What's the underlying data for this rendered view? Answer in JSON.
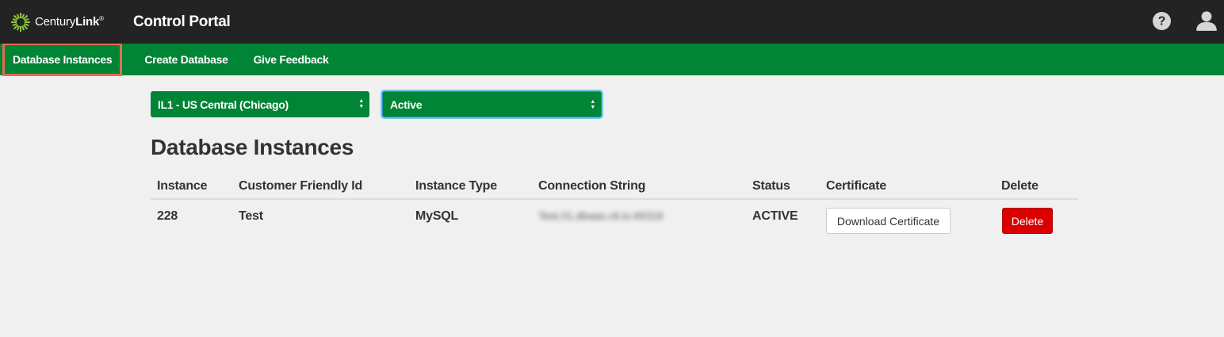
{
  "brand": {
    "name_light": "Century",
    "name_bold": "Link",
    "reg": "®",
    "portal_title": "Control Portal"
  },
  "header_icons": [
    "help-icon",
    "user-icon"
  ],
  "nav": {
    "items": [
      {
        "label": "Database Instances",
        "active": true
      },
      {
        "label": "Create Database"
      },
      {
        "label": "Give Feedback"
      }
    ]
  },
  "filters": {
    "location": "IL1 - US Central (Chicago)",
    "status": "Active"
  },
  "page": {
    "heading": "Database Instances"
  },
  "table": {
    "columns": [
      "Instance",
      "Customer Friendly Id",
      "Instance Type",
      "Connection String",
      "Status",
      "Certificate",
      "Delete"
    ],
    "rows": [
      {
        "instance": "228",
        "friendly_id": "Test",
        "type": "MySQL",
        "connection": "Test.01.dbaas.ctl.io:49316",
        "status": "ACTIVE",
        "certificate_label": "Download Certificate",
        "delete_label": "Delete"
      }
    ]
  },
  "colors": {
    "topbar": "#232323",
    "nav": "#008435",
    "delete": "#d90000",
    "highlight": "#e56c51"
  }
}
